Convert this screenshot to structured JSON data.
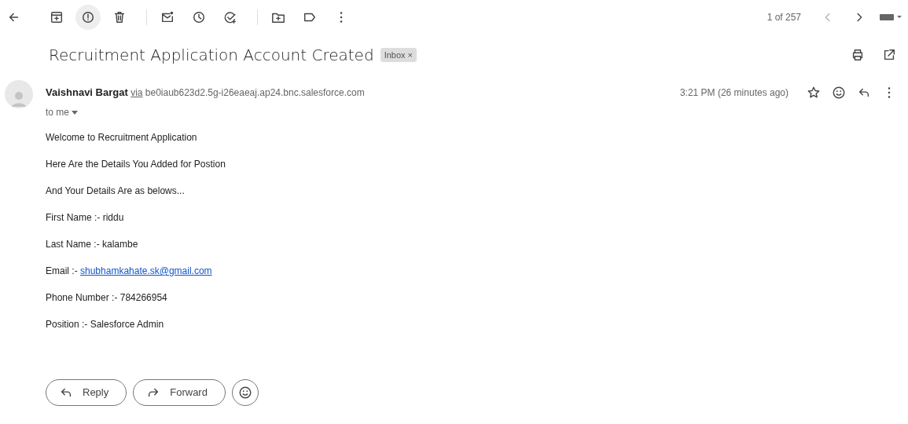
{
  "toolbar": {
    "back": {
      "kind": "back"
    },
    "actions": [
      {
        "kind": "archive",
        "highlighted": false
      },
      {
        "kind": "spam",
        "highlighted": true
      },
      {
        "kind": "delete",
        "highlighted": false
      },
      {
        "kind": "divider"
      },
      {
        "kind": "unread",
        "highlighted": false
      },
      {
        "kind": "snooze",
        "highlighted": false
      },
      {
        "kind": "task",
        "highlighted": false
      },
      {
        "kind": "divider"
      },
      {
        "kind": "move",
        "highlighted": false
      },
      {
        "kind": "label",
        "highlighted": false
      },
      {
        "kind": "more",
        "highlighted": false
      }
    ],
    "pager": "1 of 257",
    "prev_disabled": true
  },
  "subject": {
    "title": "Recruitment Application Account Created",
    "label": "Inbox",
    "label_close": "×"
  },
  "message": {
    "sender": "Vaishnavi Bargat",
    "via": "via",
    "domain": "be0iaub623d2.5g-i26eaeaj.ap24.bnc.salesforce.com",
    "recipient": "to me",
    "time": "3:21 PM (26 minutes ago)",
    "starred": false,
    "body": [
      {
        "kind": "text",
        "text": "Welcome to Recruitment Application"
      },
      {
        "kind": "text",
        "text": "Here Are the Details You Added for Postion"
      },
      {
        "kind": "text",
        "text": "And Your Details Are as belows..."
      },
      {
        "kind": "text",
        "text": "First Name :- riddu"
      },
      {
        "kind": "text",
        "text": "Last Name :- kalambe"
      },
      {
        "kind": "link",
        "text": "Email :- ",
        "link": "shubhamkahate.sk@gmail.com"
      },
      {
        "kind": "text",
        "text": "Phone Number :- 784266954"
      },
      {
        "kind": "text",
        "text": "Position :- Salesforce Admin"
      }
    ]
  },
  "reply_buttons": [
    {
      "kind": "reply",
      "label": "Reply"
    },
    {
      "kind": "forward",
      "label": "Forward"
    },
    {
      "kind": "emoji"
    }
  ]
}
